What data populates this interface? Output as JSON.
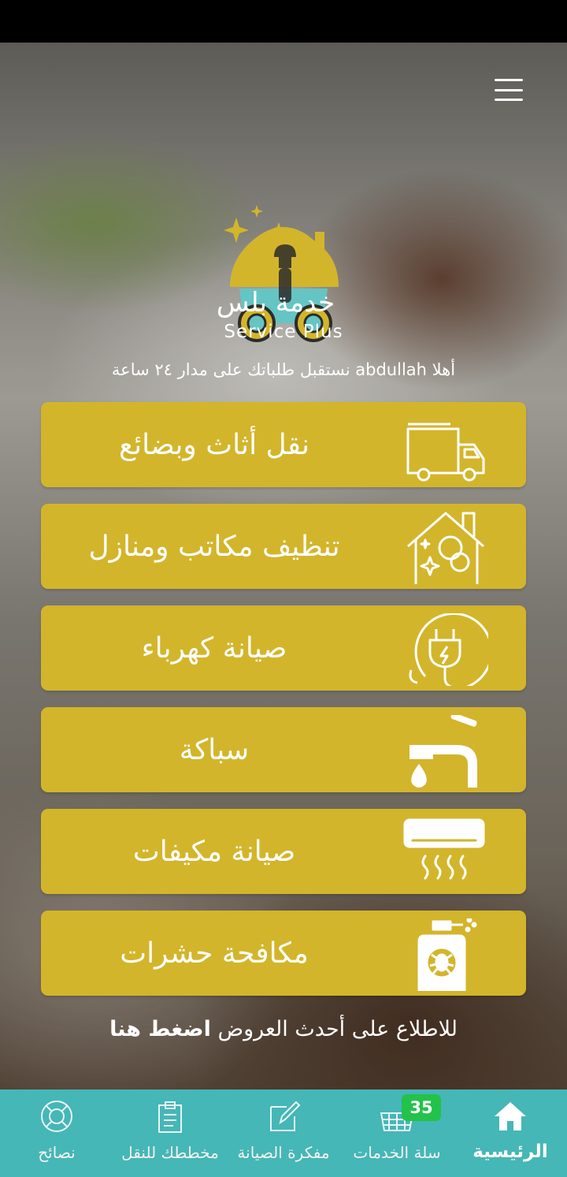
{
  "header": {
    "menu_icon": "hamburger-icon"
  },
  "logo": {
    "name_ar": "خدمة بلس",
    "name_en": "Service Plus",
    "colors": {
      "gold": "#d3b52b",
      "teal": "#64c5c4"
    }
  },
  "welcome_text": "أهلا abdullah نستقبل طلباتك على مدار ٢٤ ساعة",
  "services": [
    {
      "label": "نقل أثاث وبضائع",
      "icon": "truck-icon"
    },
    {
      "label": "تنظيف مكاتب ومنازل",
      "icon": "house-cleaning-icon"
    },
    {
      "label": "صيانة كهرباء",
      "icon": "electric-plug-icon"
    },
    {
      "label": "سباكة",
      "icon": "faucet-icon"
    },
    {
      "label": "صيانة مكيفات",
      "icon": "air-conditioner-icon"
    },
    {
      "label": "مكافحة حشرات",
      "icon": "pest-sprayer-icon"
    }
  ],
  "offers": {
    "text": "للاطلاع على أحدث العروض",
    "link": "اضغط هنا"
  },
  "bottom_nav": [
    {
      "label": "الرئيسية",
      "icon": "home-icon",
      "active": true
    },
    {
      "label": "سلة الخدمات",
      "icon": "basket-icon",
      "badge": "35"
    },
    {
      "label": "مفكرة الصيانة",
      "icon": "notepad-icon"
    },
    {
      "label": "مخططك للنقل",
      "icon": "clipboard-icon"
    },
    {
      "label": "نصائح",
      "icon": "lifebuoy-icon"
    }
  ],
  "colors": {
    "card": "#d3b52b",
    "nav_bar": "#45b7b6",
    "badge": "#23c24a"
  }
}
